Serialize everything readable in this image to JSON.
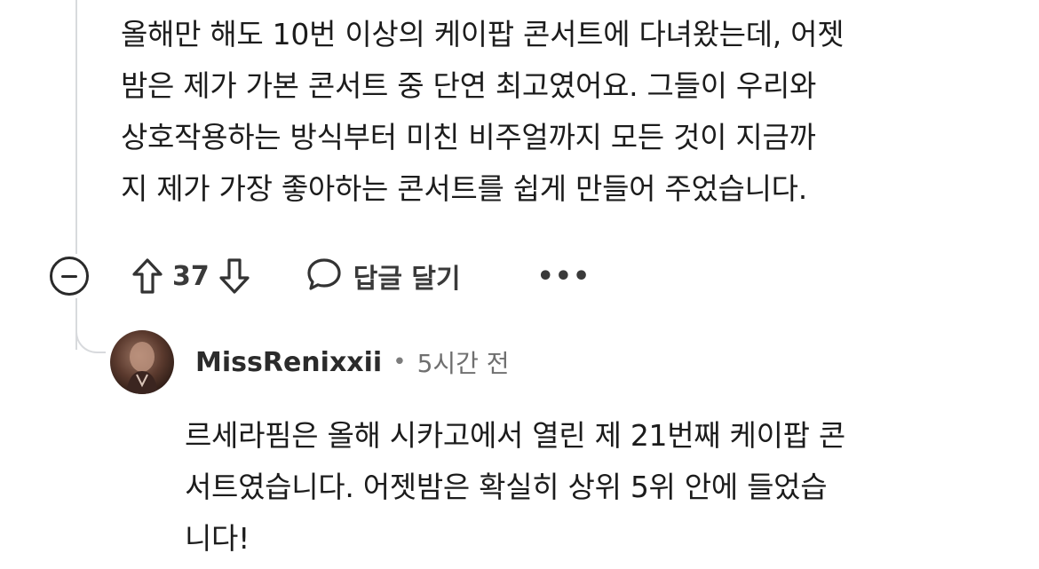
{
  "comment": {
    "lines": [
      "올해만 해도 10번 이상의 케이팝 콘서트에 다녀왔는데, 어젯",
      "밤은 제가 가본 콘서트 중 단연 최고였어요. 그들이 우리와",
      "상호작용하는 방식부터 미친 비주얼까지 모든 것이 지금까",
      "지 제가 가장 좋아하는 콘서트를 쉽게 만들어 주었습니다."
    ],
    "score": "37",
    "reply_label": "답글 달기",
    "more_label": "•••"
  },
  "reply": {
    "username": "MissRenixxii",
    "separator": "•",
    "timestamp": "5시간 전",
    "lines": [
      "르세라핌은 올해 시카고에서 열린 제 21번째 케이팝 콘",
      "서트였습니다. 어젯밤은 확실히 상위 5위 안에 들었습",
      "니다!"
    ]
  },
  "icons": {
    "collapse": "minus-circle-icon",
    "upvote": "arrow-up-outline-icon",
    "downvote": "arrow-down-outline-icon",
    "reply": "speech-bubble-icon",
    "more": "ellipsis-icon"
  },
  "colors": {
    "text": "#1c1c1c",
    "meta": "#6f6f6f",
    "thread_line": "#d8dadd"
  }
}
